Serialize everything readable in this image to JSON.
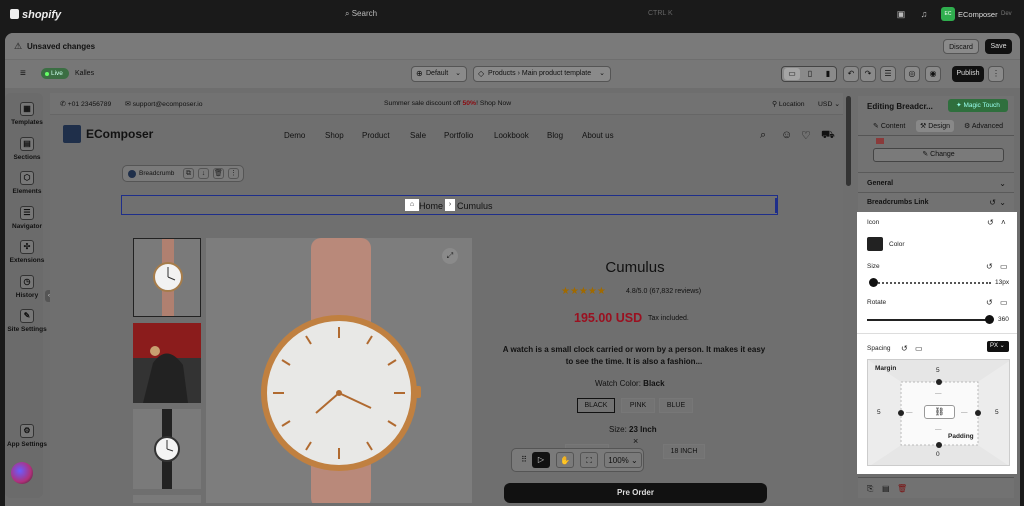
{
  "topbar": {
    "platform": "shopify",
    "search_placeholder": "Search",
    "shortcut": "CTRL K",
    "store_badge": "EC",
    "store_name": "EComposer",
    "store_sub": "Dev"
  },
  "notice": {
    "text": "Unsaved changes",
    "discard": "Discard",
    "save": "Save"
  },
  "editor": {
    "status": "Live",
    "theme": "Kalles",
    "view": "Default",
    "template_type": "Products",
    "template_name": "Main product template",
    "publish": "Publish"
  },
  "leftnav": {
    "items": [
      {
        "label": "Templates",
        "icon": "templates-icon"
      },
      {
        "label": "Sections",
        "icon": "sections-icon"
      },
      {
        "label": "Elements",
        "icon": "elements-icon"
      },
      {
        "label": "Navigator",
        "icon": "navigator-icon"
      },
      {
        "label": "Extensions",
        "icon": "extensions-icon"
      },
      {
        "label": "History",
        "icon": "history-icon"
      },
      {
        "label": "Site Settings",
        "icon": "brush-icon"
      }
    ],
    "app_settings": "App Settings"
  },
  "store": {
    "phone": "+01 23456789",
    "email": "support@ecomposer.io",
    "promo_prefix": "Summer sale discount off ",
    "promo_pct": "50%",
    "promo_suffix": "! Shop Now",
    "location": "Location",
    "currency": "USD",
    "brand": "EComposer",
    "menu": [
      "Demo",
      "Shop",
      "Product",
      "Sale",
      "Portfolio",
      "Lookbook",
      "Blog",
      "About us"
    ]
  },
  "breadcrumb_toolbar": {
    "label": "Breadcrumb"
  },
  "breadcrumb": {
    "home": "Home",
    "current": "Cumulus"
  },
  "product": {
    "title": "Cumulus",
    "rating_text": "4.8/5.0 (67,832 reviews)",
    "price": "195.00 USD",
    "tax": "Tax included.",
    "description": "A watch is a small clock carried or worn by a person. It makes it easy to see the time. It is also a fashion...",
    "color_label": "Watch Color: ",
    "color_value": "Black",
    "colors": [
      "BLACK",
      "PINK",
      "BLUE"
    ],
    "size_label": "Size: ",
    "size_value": "23 Inch",
    "size_option": "18 INCH",
    "preorder": "Pre Order"
  },
  "canvas_tools": {
    "zoom": "100%"
  },
  "panel": {
    "title": "Editing Breadcr...",
    "magic": "Magic Touch",
    "tabs": [
      "Content",
      "Design",
      "Advanced"
    ],
    "change": "Change",
    "sections": [
      "General",
      "Breadcrumbs Link"
    ],
    "icon_section": "Icon",
    "color_label": "Color",
    "size_label": "Size",
    "size_value": "13px",
    "size_fraction": 0.02,
    "rotate_label": "Rotate",
    "rotate_value": "360",
    "spacing_label": "Spacing",
    "unit": "PX",
    "margin_label": "Margin",
    "padding_label": "Padding",
    "margin_top": "5",
    "margin_left": "5",
    "margin_right": "5",
    "margin_bottom": "0",
    "padding_top": "—",
    "padding_left": "—",
    "padding_right": "—",
    "padding_bottom": "—"
  },
  "colors": {
    "accent": "#2fae4e",
    "price": "#9a1020",
    "selection": "#1e2e8a"
  }
}
